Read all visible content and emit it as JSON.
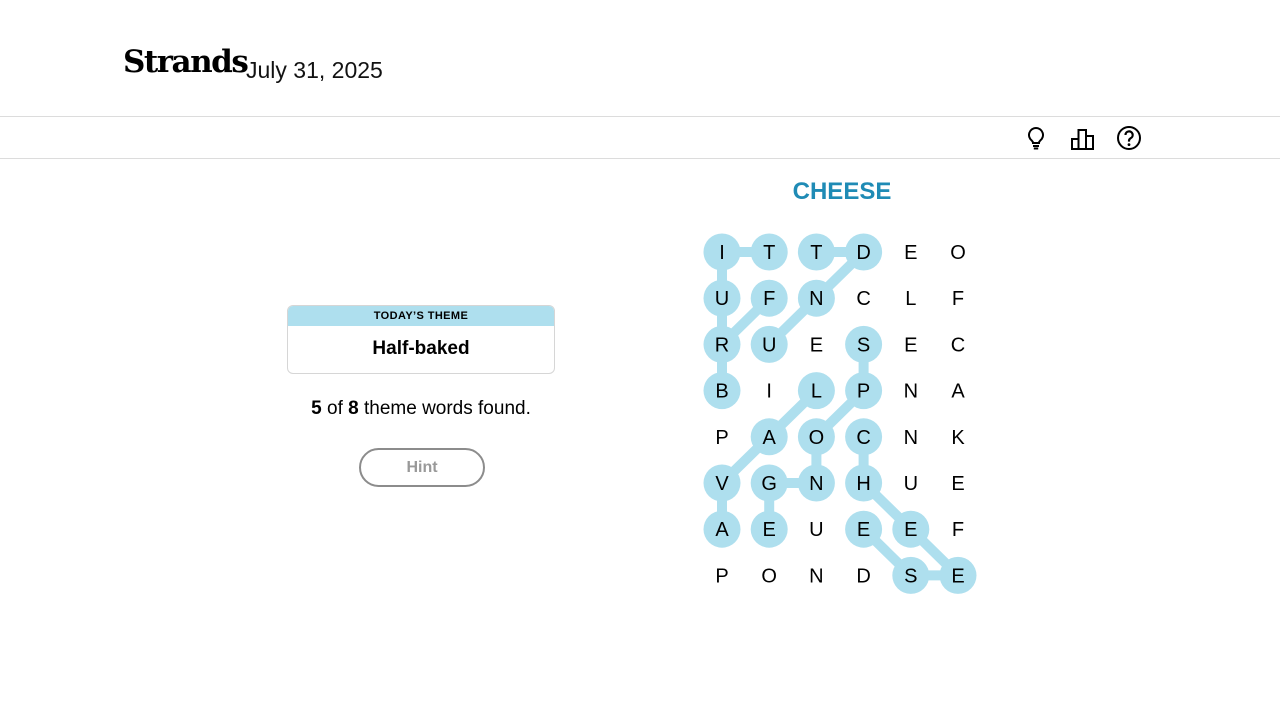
{
  "header": {
    "logo": "Strands",
    "date": "July 31, 2025"
  },
  "toolbar": {
    "icons": [
      "lightbulb-icon",
      "leaderboard-icon",
      "help-icon"
    ]
  },
  "theme": {
    "label": "TODAY’S THEME",
    "name": "Half-baked"
  },
  "progress": {
    "found": "5",
    "of_label": " of ",
    "total": "8",
    "suffix": " theme words found."
  },
  "hint": {
    "label": "Hint"
  },
  "spangram": {
    "word": "CHEESE"
  },
  "colors": {
    "highlight": "#aedfee",
    "spangram": "#1f8bb5",
    "text": "#000000"
  },
  "board": {
    "rows": [
      [
        "I",
        "T",
        "T",
        "D",
        "E",
        "O"
      ],
      [
        "U",
        "F",
        "N",
        "C",
        "L",
        "F"
      ],
      [
        "R",
        "U",
        "E",
        "S",
        "E",
        "C"
      ],
      [
        "B",
        "I",
        "L",
        "P",
        "N",
        "A"
      ],
      [
        "P",
        "A",
        "O",
        "C",
        "N",
        "K"
      ],
      [
        "V",
        "G",
        "N",
        "H",
        "U",
        "E"
      ],
      [
        "A",
        "E",
        "U",
        "E",
        "E",
        "F"
      ],
      [
        "P",
        "O",
        "N",
        "D",
        "S",
        "E"
      ]
    ],
    "highlighted": [
      [
        0,
        0
      ],
      [
        0,
        1
      ],
      [
        0,
        2
      ],
      [
        0,
        3
      ],
      [
        1,
        0
      ],
      [
        1,
        1
      ],
      [
        1,
        2
      ],
      [
        2,
        0
      ],
      [
        2,
        1
      ],
      [
        2,
        3
      ],
      [
        3,
        0
      ],
      [
        3,
        2
      ],
      [
        3,
        3
      ],
      [
        4,
        1
      ],
      [
        4,
        2
      ],
      [
        4,
        3
      ],
      [
        5,
        0
      ],
      [
        5,
        1
      ],
      [
        5,
        2
      ],
      [
        5,
        3
      ],
      [
        6,
        0
      ],
      [
        6,
        1
      ],
      [
        6,
        3
      ],
      [
        6,
        4
      ],
      [
        7,
        4
      ],
      [
        7,
        5
      ]
    ],
    "paths": [
      [
        [
          0,
          0
        ],
        [
          0,
          1
        ]
      ],
      [
        [
          0,
          0
        ],
        [
          1,
          0
        ]
      ],
      [
        [
          1,
          0
        ],
        [
          2,
          0
        ]
      ],
      [
        [
          2,
          0
        ],
        [
          3,
          0
        ]
      ],
      [
        [
          0,
          2
        ],
        [
          0,
          3
        ]
      ],
      [
        [
          0,
          3
        ],
        [
          1,
          2
        ]
      ],
      [
        [
          1,
          2
        ],
        [
          2,
          1
        ]
      ],
      [
        [
          1,
          1
        ],
        [
          2,
          0
        ]
      ],
      [
        [
          2,
          3
        ],
        [
          3,
          3
        ]
      ],
      [
        [
          3,
          3
        ],
        [
          4,
          2
        ]
      ],
      [
        [
          4,
          2
        ],
        [
          5,
          2
        ]
      ],
      [
        [
          5,
          1
        ],
        [
          5,
          2
        ]
      ],
      [
        [
          5,
          1
        ],
        [
          6,
          1
        ]
      ],
      [
        [
          3,
          2
        ],
        [
          4,
          1
        ]
      ],
      [
        [
          4,
          1
        ],
        [
          5,
          0
        ]
      ],
      [
        [
          5,
          0
        ],
        [
          6,
          0
        ]
      ],
      [
        [
          4,
          3
        ],
        [
          5,
          3
        ]
      ],
      [
        [
          5,
          3
        ],
        [
          6,
          4
        ]
      ],
      [
        [
          6,
          4
        ],
        [
          7,
          5
        ]
      ],
      [
        [
          6,
          3
        ],
        [
          7,
          4
        ]
      ],
      [
        [
          7,
          4
        ],
        [
          7,
          5
        ]
      ]
    ]
  }
}
